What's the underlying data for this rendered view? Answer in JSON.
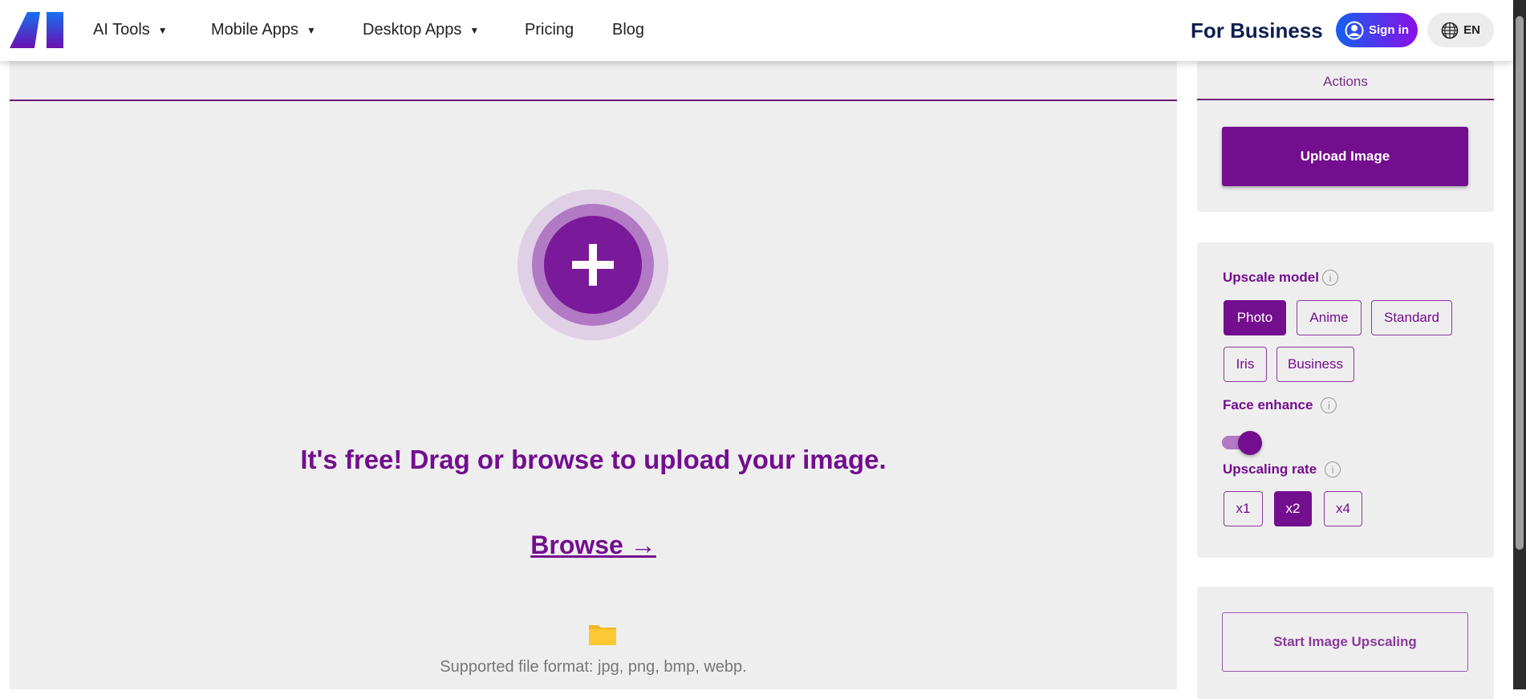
{
  "nav": {
    "items": [
      {
        "label": "AI Tools",
        "dropdown": true
      },
      {
        "label": "Mobile Apps",
        "dropdown": true
      },
      {
        "label": "Desktop Apps",
        "dropdown": true
      },
      {
        "label": "Pricing"
      },
      {
        "label": "Blog"
      }
    ],
    "for_business": "For Business",
    "sign_in": "Sign in",
    "language": "EN"
  },
  "upload_area": {
    "heading": "It's free! Drag or browse to upload your image.",
    "browse": "Browse →",
    "supported": "Supported file format: jpg, png, bmp, webp."
  },
  "sidebar": {
    "actions_title": "Actions",
    "upload_button": "Upload Image",
    "upscale_model": {
      "label": "Upscale model",
      "options": [
        "Photo",
        "Anime",
        "Standard",
        "Iris",
        "Business"
      ],
      "selected": "Photo"
    },
    "face_enhance": {
      "label": "Face enhance",
      "enabled": true
    },
    "upscaling_rate": {
      "label": "Upscaling rate",
      "options": [
        "x1",
        "x2",
        "x4"
      ],
      "selected": "x2"
    },
    "start_button": "Start Image Upscaling"
  },
  "colors": {
    "accent": "#730e8e",
    "background": "#eeeeee"
  }
}
